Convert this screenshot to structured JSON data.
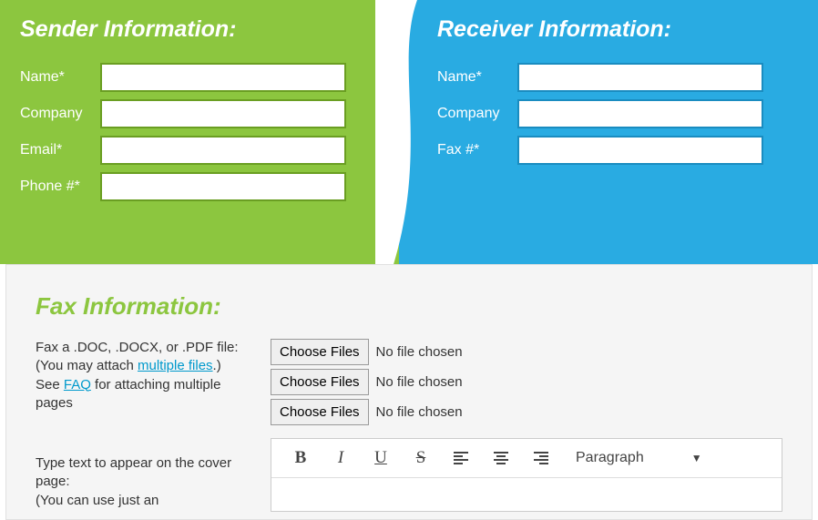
{
  "sender": {
    "title": "Sender Information:",
    "fields": {
      "name": {
        "label": "Name*",
        "value": ""
      },
      "company": {
        "label": "Company",
        "value": ""
      },
      "email": {
        "label": "Email*",
        "value": ""
      },
      "phone": {
        "label": "Phone #*",
        "value": ""
      }
    }
  },
  "receiver": {
    "title": "Receiver Information:",
    "fields": {
      "name": {
        "label": "Name*",
        "value": ""
      },
      "company": {
        "label": "Company",
        "value": ""
      },
      "fax": {
        "label": "Fax #*",
        "value": ""
      }
    }
  },
  "fax": {
    "title": "Fax Information:",
    "file_prompt_1": "Fax a .DOC, .DOCX, or .PDF file:",
    "file_prompt_2a": "(You may attach ",
    "file_prompt_2_link": "multiple files",
    "file_prompt_2b": ".)",
    "file_prompt_3a": "See ",
    "file_prompt_3_link": "FAQ",
    "file_prompt_3b": " for attaching multiple pages",
    "choose_label": "Choose Files",
    "no_file": "No file chosen",
    "cover_prompt_1": "Type text to appear on the cover page:",
    "cover_prompt_2": "(You can use just an",
    "editor": {
      "paragraph_label": "Paragraph"
    }
  }
}
